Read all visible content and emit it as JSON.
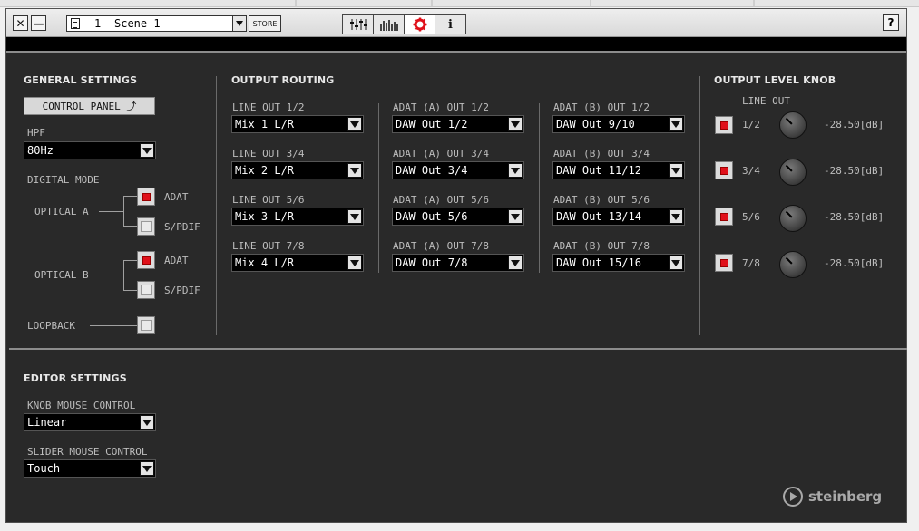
{
  "titlebar": {
    "close_label": "✕",
    "minimize_label": "—",
    "scene_number": "1",
    "scene_name": "Scene 1",
    "store_label": "STORE",
    "help_label": "?",
    "tabs": [
      {
        "icon": "mixer-sliders-icon",
        "label": "⫲"
      },
      {
        "icon": "meter-bars-icon",
        "label": "▥"
      },
      {
        "icon": "settings-gear-icon",
        "label": "⚙"
      },
      {
        "icon": "info-icon",
        "label": "i"
      }
    ]
  },
  "general": {
    "heading": "GENERAL SETTINGS",
    "control_panel_label": "CONTROL PANEL ⤴",
    "hpf_label": "HPF",
    "hpf_value": "80Hz",
    "digital_mode_label": "DIGITAL MODE",
    "optical_a_label": "OPTICAL A",
    "optical_b_label": "OPTICAL B",
    "adat_label": "ADAT",
    "spdif_label": "S/PDIF",
    "loopback_label": "LOOPBACK",
    "optical_a_mode": "ADAT",
    "optical_b_mode": "ADAT",
    "loopback_on": false
  },
  "routing": {
    "heading": "OUTPUT ROUTING",
    "columns": [
      {
        "items": [
          {
            "label": "LINE OUT 1/2",
            "value": "Mix 1 L/R"
          },
          {
            "label": "LINE OUT 3/4",
            "value": "Mix 2 L/R"
          },
          {
            "label": "LINE OUT 5/6",
            "value": "Mix 3 L/R"
          },
          {
            "label": "LINE OUT 7/8",
            "value": "Mix 4 L/R"
          }
        ]
      },
      {
        "items": [
          {
            "label": "ADAT (A) OUT 1/2",
            "value": "DAW Out 1/2"
          },
          {
            "label": "ADAT (A) OUT 3/4",
            "value": "DAW Out 3/4"
          },
          {
            "label": "ADAT (A) OUT 5/6",
            "value": "DAW Out 5/6"
          },
          {
            "label": "ADAT (A) OUT 7/8",
            "value": "DAW Out 7/8"
          }
        ]
      },
      {
        "items": [
          {
            "label": "ADAT (B) OUT 1/2",
            "value": "DAW Out 9/10"
          },
          {
            "label": "ADAT (B) OUT 3/4",
            "value": "DAW Out 11/12"
          },
          {
            "label": "ADAT (B) OUT 5/6",
            "value": "DAW Out 13/14"
          },
          {
            "label": "ADAT (B) OUT 7/8",
            "value": "DAW Out 15/16"
          }
        ]
      }
    ]
  },
  "level_knob": {
    "heading": "OUTPUT LEVEL KNOB",
    "subheading": "LINE OUT",
    "rows": [
      {
        "label": "1/2",
        "enabled": true,
        "value": "-28.50[dB]"
      },
      {
        "label": "3/4",
        "enabled": true,
        "value": "-28.50[dB]"
      },
      {
        "label": "5/6",
        "enabled": true,
        "value": "-28.50[dB]"
      },
      {
        "label": "7/8",
        "enabled": true,
        "value": "-28.50[dB]"
      }
    ]
  },
  "editor": {
    "heading": "EDITOR SETTINGS",
    "knob_mouse_label": "KNOB MOUSE CONTROL",
    "knob_mouse_value": "Linear",
    "slider_mouse_label": "SLIDER MOUSE CONTROL",
    "slider_mouse_value": "Touch"
  },
  "branding": {
    "logo_text": "steinberg"
  },
  "colors": {
    "panel_bg": "#292929",
    "indicator_red": "#e0101a",
    "text_gray": "#bdbdbd"
  }
}
